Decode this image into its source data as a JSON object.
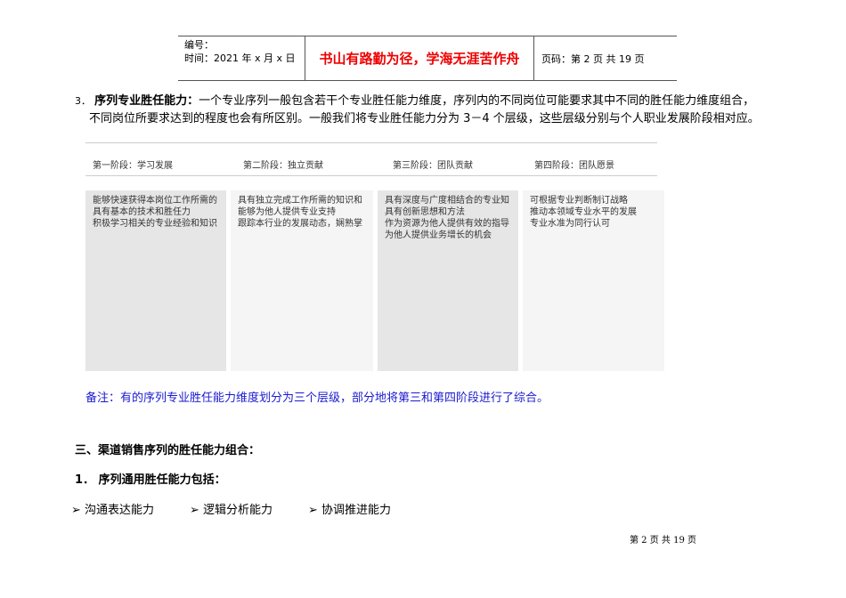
{
  "header": {
    "number_label": "编号：",
    "date_label": "时间：2021 年 x 月 x 日",
    "motto": "书山有路勤为径，学海无涯苦作舟",
    "page_info": "页码：第 2 页  共 19 页"
  },
  "section3": {
    "number": "3．",
    "title": "序列专业胜任能力：",
    "line1": "一个专业序列一般包含若干个专业胜任能力维度，序列内的不同岗位可能要求其中不同的胜任能力维度组合，",
    "line2": "不同岗位所要求达到的程度也会有所区别。一般我们将专业胜任能力分为 3－4 个层级，这些层级分别与个人职业发展阶段相对应。"
  },
  "stages": [
    "第一阶段：学习发展",
    "第二阶段：独立贡献",
    "第三阶段：团队贡献",
    "第四阶段：团队愿景"
  ],
  "boxes": [
    [
      "能够快速获得本岗位工作所需的",
      "具有基本的技术和胜任力",
      "积极学习相关的专业经验和知识"
    ],
    [
      "具有独立完成工作所需的知识和",
      "能够为他人提供专业支持",
      "跟踪本行业的发展动态，娴熟掌"
    ],
    [
      "具有深度与广度相结合的专业知",
      "具有创新思想和方法",
      "作为资源为他人提供有效的指导",
      "为他人提供业务增长的机会"
    ],
    [
      "可根据专业判断制订战略",
      "推动本领域专业水平的发展",
      "专业水准为同行认可"
    ]
  ],
  "note": "备注：有的序列专业胜任能力维度划分为三个层级，部分地将第三和第四阶段进行了综合。",
  "section_three_title": "三、渠道销售序列的胜任能力组合：",
  "sub1": "1．  序列通用胜任能力包括：",
  "bullets": [
    "沟通表达能力",
    "逻辑分析能力",
    "协调推进能力"
  ],
  "footer": "第  2  页  共  19  页"
}
